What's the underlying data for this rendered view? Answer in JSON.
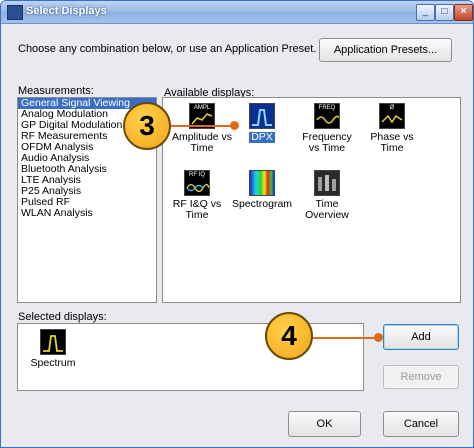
{
  "window": {
    "title": "Select Displays"
  },
  "prompt": "Choose any combination below, or use an Application Preset.",
  "buttons": {
    "app_presets": "Application Presets...",
    "add": "Add",
    "remove": "Remove",
    "ok": "OK",
    "cancel": "Cancel"
  },
  "measurements": {
    "label": "Measurements:",
    "items": [
      "General Signal Viewing",
      "Analog Modulation",
      "GP Digital Modulation",
      "RF Measurements",
      "OFDM Analysis",
      "Audio Analysis",
      "Bluetooth Analysis",
      "LTE Analysis",
      "P25 Analysis",
      "Pulsed RF",
      "WLAN Analysis"
    ],
    "selected_index": 0
  },
  "available": {
    "label": "Available displays:",
    "items": [
      {
        "label": "Amplitude vs Time",
        "icon_caption": "AMPL",
        "icon": "amplitude-vs-time-icon"
      },
      {
        "label": "DPX",
        "icon_caption": "",
        "icon": "dpx-icon",
        "selected": true
      },
      {
        "label": "Frequency vs Time",
        "icon_caption": "FREQ",
        "icon": "frequency-vs-time-icon"
      },
      {
        "label": "Phase vs Time",
        "icon_caption": "Ø",
        "icon": "phase-vs-time-icon"
      },
      {
        "label": "RF I&Q vs Time",
        "icon_caption": "RF IQ",
        "icon": "rf-iq-vs-time-icon"
      },
      {
        "label": "Spectrogram",
        "icon_caption": "",
        "icon": "spectrogram-icon"
      },
      {
        "label": "Time Overview",
        "icon_caption": "",
        "icon": "time-overview-icon"
      }
    ]
  },
  "selected": {
    "label": "Selected displays:",
    "items": [
      {
        "label": "Spectrum",
        "icon": "spectrum-icon"
      }
    ]
  },
  "callouts": {
    "three": "3",
    "four": "4"
  },
  "colors": {
    "accent": "#3a6ec4",
    "callout_fill": "#f3a51a",
    "callout_line": "#e06a1c"
  }
}
